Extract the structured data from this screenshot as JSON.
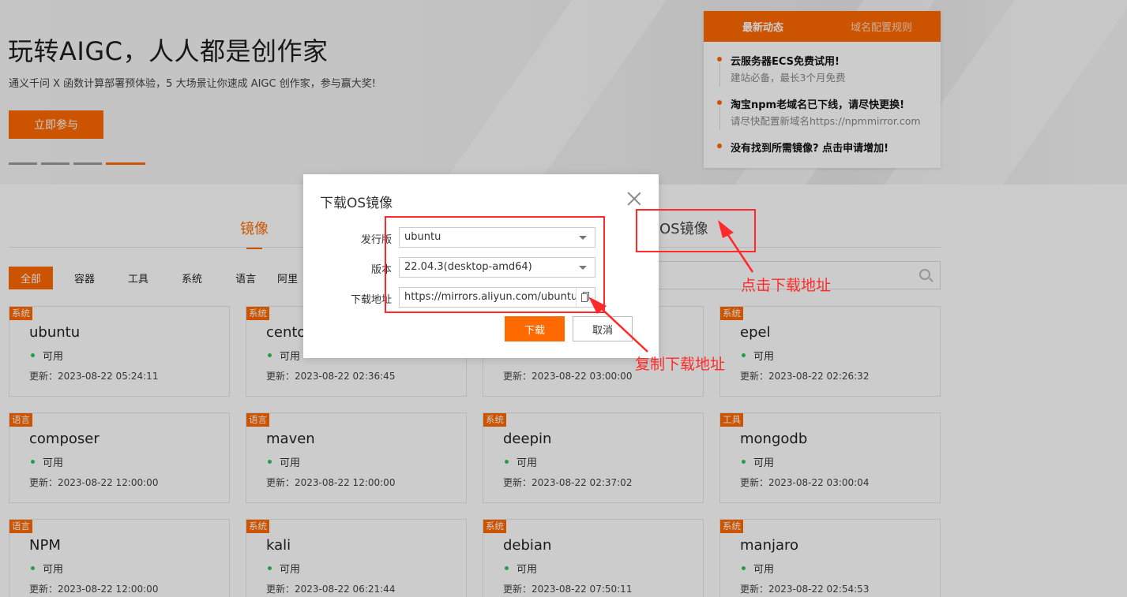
{
  "banner": {
    "title": "玩转AIGC，人人都是创作家",
    "subtitle": "通义千问 X 函数计算部署预体验，5 大场景让你速成 AIGC 创作家，参与赢大奖!",
    "cta_label": "立即参与"
  },
  "news": {
    "tabs": [
      "最新动态",
      "域名配置规则"
    ],
    "items": [
      {
        "title": "云服务器ECS免费试用!",
        "sub": "建站必备，最长3个月免费"
      },
      {
        "title": "淘宝npm老域名已下线，请尽快更换!",
        "sub": "请尽快配置新域名https://npmmirror.com"
      },
      {
        "title": "没有找到所需镜像? 点击申请增加!",
        "sub": ""
      }
    ]
  },
  "main_tabs": {
    "mirror": "镜像",
    "os_mirror": "OS镜像"
  },
  "filters": [
    "全部",
    "容器",
    "工具",
    "系统",
    "语言",
    "阿里"
  ],
  "cards": [
    {
      "tag": "系统",
      "name": "ubuntu",
      "status": "可用",
      "updated": "更新：2023-08-22 05:24:11"
    },
    {
      "tag": "系统",
      "name": "centos",
      "status": "可用",
      "updated": "更新：2023-08-22 02:36:45"
    },
    {
      "tag": "",
      "name": "",
      "status": "",
      "updated": "更新：2023-08-22 03:00:00"
    },
    {
      "tag": "系统",
      "name": "epel",
      "status": "可用",
      "updated": "更新：2023-08-22 02:26:32"
    },
    {
      "tag": "语言",
      "name": "composer",
      "status": "可用",
      "updated": "更新：2023-08-22 12:00:00"
    },
    {
      "tag": "语言",
      "name": "maven",
      "status": "可用",
      "updated": "更新：2023-08-22 12:00:00"
    },
    {
      "tag": "系统",
      "name": "deepin",
      "status": "可用",
      "updated": "更新：2023-08-22 02:37:02"
    },
    {
      "tag": "工具",
      "name": "mongodb",
      "status": "可用",
      "updated": "更新：2023-08-22 03:00:04"
    },
    {
      "tag": "语言",
      "name": "NPM",
      "status": "可用",
      "updated": "更新：2023-08-22 12:00:00"
    },
    {
      "tag": "系统",
      "name": "kali",
      "status": "可用",
      "updated": "更新：2023-08-22 06:21:44"
    },
    {
      "tag": "系统",
      "name": "debian",
      "status": "可用",
      "updated": "更新：2023-08-22 07:50:11"
    },
    {
      "tag": "系统",
      "name": "manjaro",
      "status": "可用",
      "updated": "更新：2023-08-22 02:54:53"
    }
  ],
  "modal": {
    "title": "下载OS镜像",
    "distro_label": "发行版",
    "distro_value": "ubuntu",
    "version_label": "版本",
    "version_value": "22.04.3(desktop-amd64)",
    "url_label": "下载地址",
    "url_value": "https://mirrors.aliyun.com/ubuntu-re",
    "download_label": "下载",
    "cancel_label": "取消"
  },
  "annotations": {
    "click_download": "点击下载地址",
    "copy_download": "复制下载地址"
  },
  "colors": {
    "accent": "#ff6a00",
    "annotation": "#ff2a2a",
    "available": "#2fc25b"
  }
}
